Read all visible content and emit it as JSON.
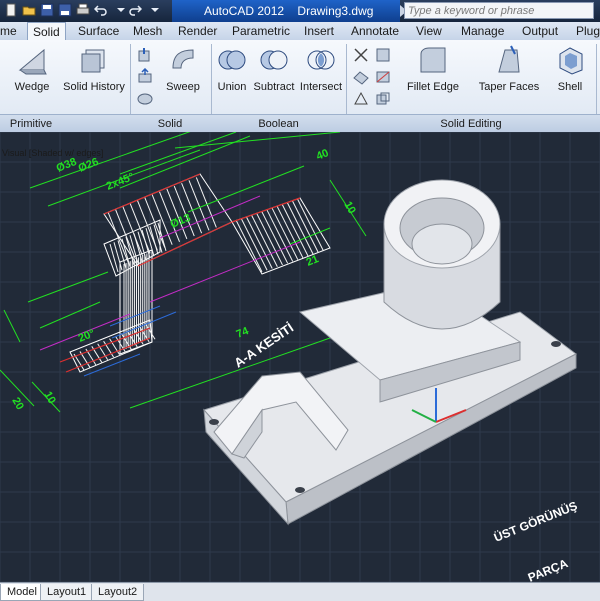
{
  "titlebar": {
    "app_title": "AutoCAD 2012",
    "doc_title": "Drawing3.dwg",
    "search_placeholder": "Type a keyword or phrase",
    "accent": "#1f63c8"
  },
  "tabs": [
    {
      "label": "me"
    },
    {
      "label": "Solid",
      "active": true
    },
    {
      "label": "Surface"
    },
    {
      "label": "Mesh"
    },
    {
      "label": "Render"
    },
    {
      "label": "Parametric"
    },
    {
      "label": "Insert"
    },
    {
      "label": "Annotate"
    },
    {
      "label": "View"
    },
    {
      "label": "Manage"
    },
    {
      "label": "Output"
    },
    {
      "label": "Plug"
    }
  ],
  "ribbon": {
    "wedge": "Wedge",
    "solid_history": "Solid History",
    "sweep": "Sweep",
    "union": "Union",
    "subtract": "Subtract",
    "intersect": "Intersect",
    "fillet_edge": "Fillet Edge",
    "taper_faces": "Taper Faces",
    "shell": "Shell",
    "panels": {
      "primitive": "Primitive",
      "solid": "Solid",
      "boolean": "Boolean",
      "solid_editing": "Solid Editing"
    }
  },
  "viewport": {
    "header_text": "Visual [Shaded w/ edges]",
    "section_label": "A-A KESİTİ",
    "view_label_1": "ÜST GÖRÜNÜŞ",
    "view_label_2": "PARÇA",
    "dims": {
      "d1": "Ø38",
      "d2": "Ø26",
      "d3": "2x45°",
      "d4": "Ø13",
      "d5": "40",
      "d6": "10",
      "d7": "21",
      "d8": "74",
      "d9": "20",
      "d10": "10",
      "d11": "20°"
    },
    "colors": {
      "background": "#212a38",
      "dimension": "#22e022",
      "hatch": "#ffffff",
      "section_fill": "#dc2f2f"
    }
  },
  "layout_tabs": [
    {
      "label": "Model",
      "active": true
    },
    {
      "label": "Layout1"
    },
    {
      "label": "Layout2"
    }
  ]
}
